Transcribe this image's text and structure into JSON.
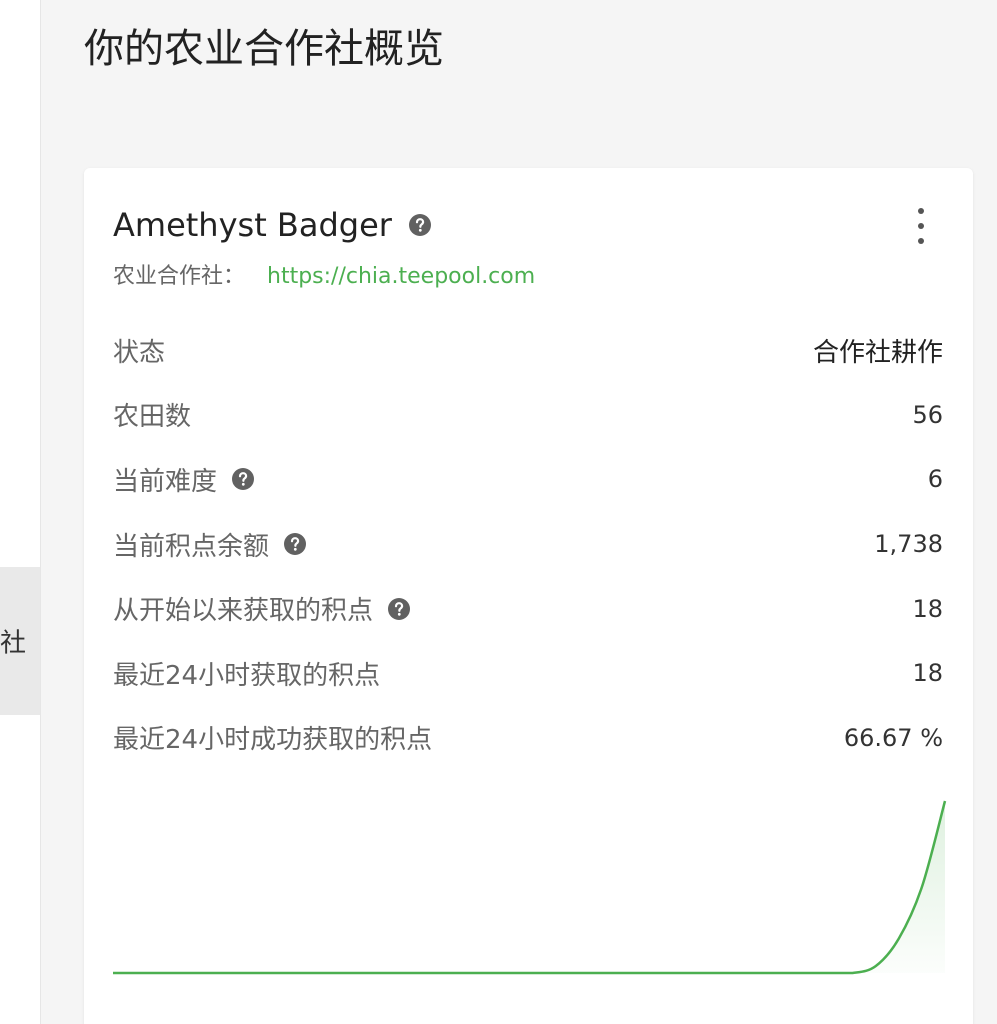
{
  "sidebar": {
    "active_item_label": "社"
  },
  "page_title": "你的农业合作社概览",
  "card": {
    "name": "Amethyst Badger",
    "pool_label": "农业合作社：",
    "pool_url": "https://chia.teepool.com",
    "stats": [
      {
        "label": "状态",
        "value": "合作社耕作",
        "help": false
      },
      {
        "label": "农田数",
        "value": "56",
        "help": false
      },
      {
        "label": "当前难度",
        "value": "6",
        "help": true
      },
      {
        "label": "当前积点余额",
        "value": "1,738",
        "help": true
      },
      {
        "label": "从开始以来获取的积点",
        "value": "18",
        "help": true
      },
      {
        "label": "最近24小时获取的积点",
        "value": "18",
        "help": false
      },
      {
        "label": "最近24小时成功获取的积点",
        "value": "66.67 %",
        "help": false
      }
    ]
  },
  "colors": {
    "accent": "#4caf50",
    "help_icon": "#616161"
  },
  "chart_data": {
    "type": "area",
    "values": [
      0,
      0,
      0,
      0,
      0,
      0,
      0,
      0,
      0,
      0,
      0,
      0,
      0,
      0,
      0,
      0,
      0,
      0,
      0,
      0,
      0,
      0,
      0,
      0,
      0,
      0,
      0,
      0,
      0,
      0,
      0,
      0,
      0,
      0.04,
      0.2,
      0.5,
      1
    ],
    "ylim": [
      0,
      1
    ],
    "grid": false,
    "axes": false
  }
}
